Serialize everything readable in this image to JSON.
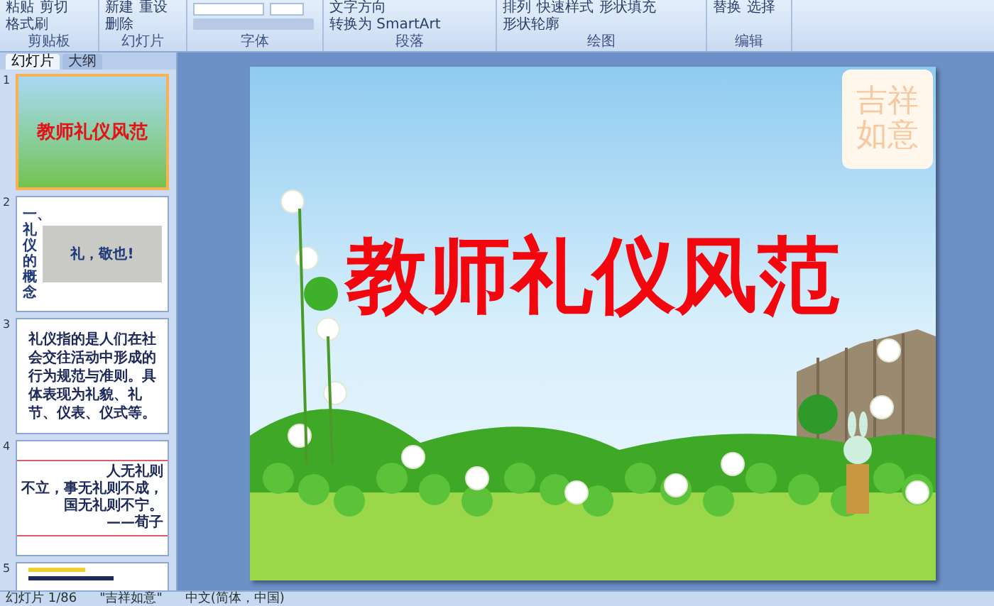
{
  "ribbon": {
    "groups": [
      {
        "label": "剪贴板",
        "buttons": [
          "粘贴",
          "剪切",
          "格式刷"
        ]
      },
      {
        "label": "幻灯片",
        "buttons": [
          "新建",
          "重设",
          "删除"
        ]
      },
      {
        "label": "字体"
      },
      {
        "label": "段落",
        "buttons": [
          "文字方向",
          "转换为 SmartArt"
        ]
      },
      {
        "label": "绘图",
        "buttons": [
          "排列",
          "快速样式",
          "形状填充",
          "形状轮廓"
        ]
      },
      {
        "label": "编辑",
        "buttons": [
          "替换",
          "选择"
        ]
      }
    ]
  },
  "pane_tabs": [
    {
      "label": "幻灯片",
      "selected": true
    },
    {
      "label": "大纲",
      "selected": false
    }
  ],
  "thumbnails": [
    {
      "number": "1",
      "kind": "title",
      "selected": true,
      "title": "教师礼仪风范"
    },
    {
      "number": "2",
      "kind": "quote",
      "selected": false,
      "side": "一、礼仪的概念",
      "caption": "礼，敬也!"
    },
    {
      "number": "3",
      "kind": "text",
      "selected": false,
      "body": "礼仪指的是人们在社会交往活动中形成的行为规范与准则。具体表现为礼貌、礼节、仪表、仪式等。"
    },
    {
      "number": "4",
      "kind": "framed",
      "selected": false,
      "lines": [
        "人无礼则",
        "不立，事无礼则不成，",
        "国无礼则不宁。",
        "——荀子"
      ]
    },
    {
      "number": "5",
      "kind": "partial",
      "selected": false
    }
  ],
  "slide": {
    "title": "教师礼仪风范",
    "seal": "吉祥如意"
  },
  "status_bar": {
    "slide_count": "幻灯片 1/86",
    "theme": "\"吉祥如意\"",
    "language": "中文(简体，中国)"
  }
}
